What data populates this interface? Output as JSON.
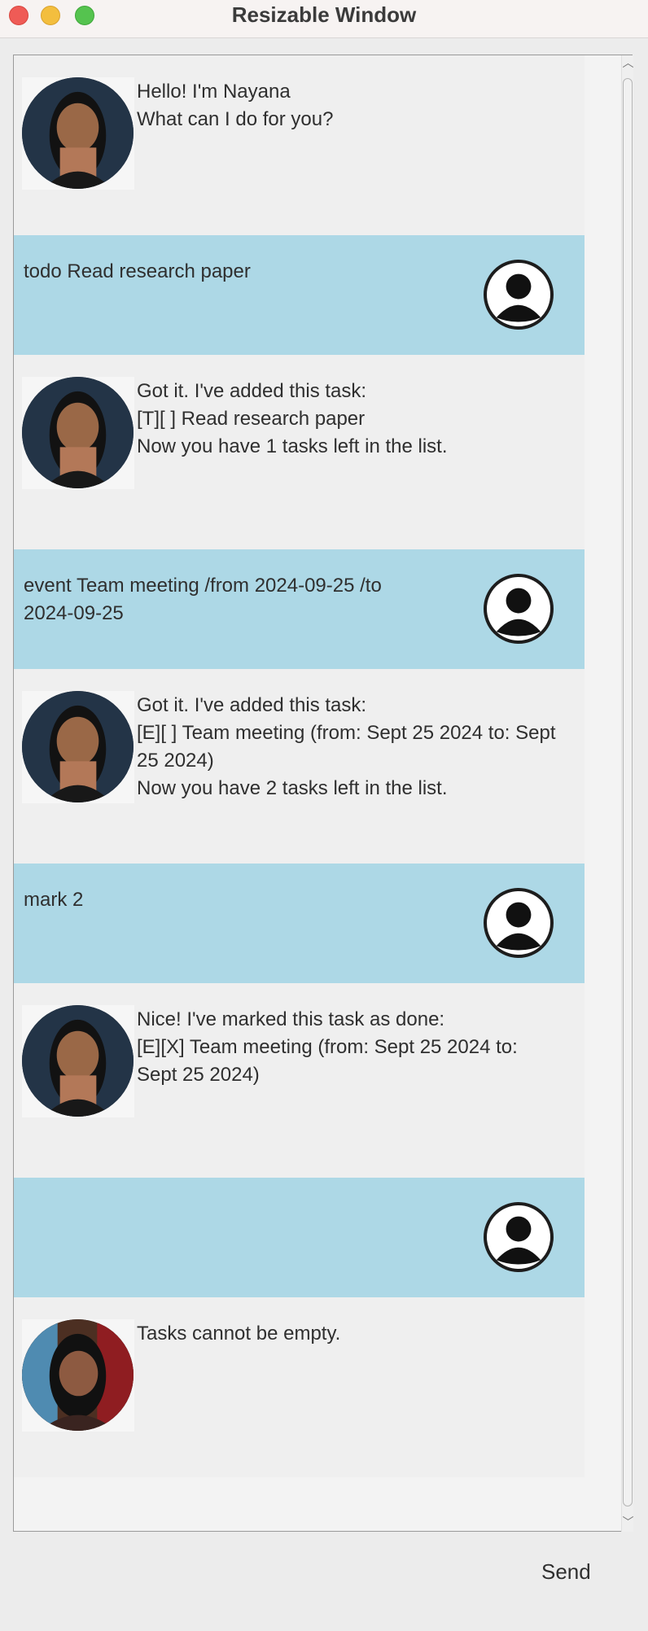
{
  "window": {
    "title": "Resizable Window"
  },
  "dialogs": [
    {
      "speaker": "nayana",
      "text": "Hello! I'm Nayana\nWhat can I do for you?"
    },
    {
      "speaker": "user",
      "text": "todo Read research paper"
    },
    {
      "speaker": "nayana",
      "text": "Got it. I've added this task:\n[T][ ] Read research paper\nNow you have 1 tasks left in the list."
    },
    {
      "speaker": "user",
      "text": "event Team meeting /from 2024-09-25 /to\n2024-09-25"
    },
    {
      "speaker": "nayana",
      "text": "Got it. I've added this task:\n[E][ ] Team meeting (from: Sept 25 2024 to: Sept\n25 2024)\nNow you have 2 tasks left in the list."
    },
    {
      "speaker": "user",
      "text": "mark 2"
    },
    {
      "speaker": "nayana",
      "text": "Nice! I've marked this task as done:\n[E][X] Team meeting (from: Sept 25 2024 to:\nSept 25 2024)"
    },
    {
      "speaker": "user",
      "text": ""
    },
    {
      "speaker": "nayana",
      "text": "Tasks cannot be empty."
    }
  ],
  "input": {
    "send_label": "Send"
  }
}
